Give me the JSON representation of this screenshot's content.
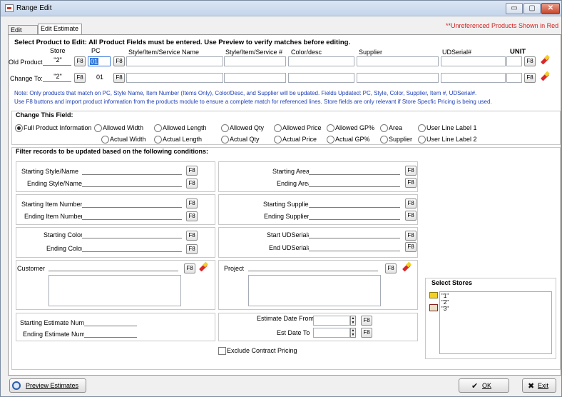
{
  "window": {
    "title": "Range Edit",
    "min_glyph": "▭",
    "max_glyph": "▢",
    "close_glyph": "✕"
  },
  "tabs": [
    {
      "label": "Edit Lines"
    },
    {
      "label": "Edit Estimate"
    }
  ],
  "notice": "**Unreferenced Products Shown in Red",
  "select_product": {
    "heading": "Select Product to Edit:  All Product Fields must be entered.  Use Preview to verify matches before editing.",
    "col_store": "Store",
    "col_pc": "PC",
    "col_style": "Style/Item/Service Name",
    "col_item": "Style/Item/Service #",
    "col_color": "Color/desc",
    "col_supplier": "Supplier",
    "col_serial": "UDSerial#",
    "col_unit": "UNIT",
    "old_label": "Old Product",
    "new_label": "Change To:",
    "old_store": "\"2\"",
    "old_pc": "01",
    "new_store": "\"2\"",
    "new_pc": "01",
    "f8": "F8",
    "note1": "Note: Only products that match on PC, Style Name, Item Number (Items Only), Color/Desc, and Supplier will be updated.  Fields Updated:  PC, Style, Color, Supplier, Item #, UDSerial#.",
    "note2": "Use F8 buttons and import product information from the products module to ensure a complete match for referenced lines.  Store fields are only relevant if Store Specfic Pricing is being used."
  },
  "change_field": {
    "heading": "Change This Field:",
    "options": {
      "full": "Full Product Information",
      "aw": "Allowed Width",
      "al": "Allowed Length",
      "aq": "Allowed Qty",
      "ap": "Allowed Price",
      "ag": "Allowed GP%",
      "area": "Area",
      "ul1": "User Line Label 1",
      "xw": "Actual Width",
      "xl": "Actual Length",
      "xq": "Actual Qty",
      "xp": "Actual Price",
      "xg": "Actual GP%",
      "sup": "Supplier",
      "ul2": "User Line Label 2"
    }
  },
  "filter": {
    "heading": "Filter records to be updated based on the following conditions:",
    "start_style": "Starting Style/Name",
    "end_style": "Ending Style/Name",
    "start_area": "Starting Area",
    "end_area": "Ending Area",
    "start_item": "Starting Item Number",
    "end_item": "Ending Item Number",
    "start_supplier": "Starting Supplier",
    "end_supplier": "Ending Supplier",
    "start_color": "Starting Color",
    "end_color": "Ending Color",
    "start_serial": "Start UDSerial#",
    "end_serial": "End UDSerial#",
    "customer": "Customer",
    "project": "Project",
    "start_est": "Starting Estimate Num",
    "end_est": "Ending Estimate Num",
    "date_from": "Estimate Date From",
    "date_to": "Est Date To",
    "exclude": "Exclude Contract Pricing"
  },
  "stores": {
    "heading": "Select Stores",
    "items": [
      "\"1\"",
      "\"2\"",
      "\"3\""
    ]
  },
  "buttons": {
    "preview": "Preview Estimates",
    "ok": "OK",
    "exit": "Exit",
    "ok_glyph": "✔",
    "exit_glyph": "✖"
  }
}
